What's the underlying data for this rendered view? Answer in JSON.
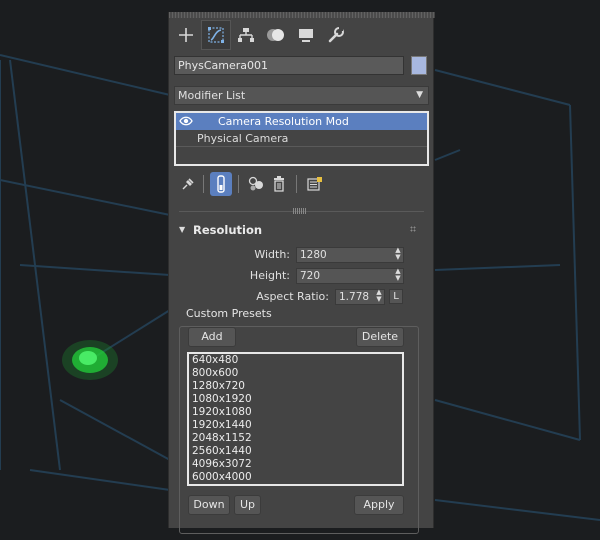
{
  "panel": {
    "tabs": [
      {
        "icon": "create-plus-icon"
      },
      {
        "icon": "modify-icon"
      },
      {
        "icon": "hierarchy-icon"
      },
      {
        "icon": "motion-icon"
      },
      {
        "icon": "display-icon"
      },
      {
        "icon": "utilities-wrench-icon"
      }
    ],
    "object_name": "PhysCamera001",
    "object_color": "#a8b8e0",
    "modifier_list_label": "Modifier List",
    "stack": [
      {
        "label": "Camera Resolution Mod",
        "selected": true
      },
      {
        "label": "Physical Camera",
        "selected": false
      }
    ]
  },
  "rollout": {
    "title": "Resolution",
    "width_label": "Width:",
    "width_value": "1280",
    "height_label": "Height:",
    "height_value": "720",
    "aspect_label": "Aspect Ratio:",
    "aspect_value": "1.778",
    "lock_label": "L",
    "presets_group_label": "Custom Presets",
    "add_label": "Add",
    "delete_label": "Delete",
    "presets": [
      "640x480",
      "800x600",
      "1280x720",
      "1080x1920",
      "1920x1080",
      "1920x1440",
      "2048x1152",
      "2560x1440",
      "4096x3072",
      "6000x4000"
    ],
    "down_label": "Down",
    "up_label": "Up",
    "apply_label": "Apply"
  },
  "colors": {
    "selection_blue": "#5b7fbf",
    "panel_bg": "#444444",
    "viewport_wire": "#2a4a63",
    "viewport_highlight": "#23d13a"
  }
}
